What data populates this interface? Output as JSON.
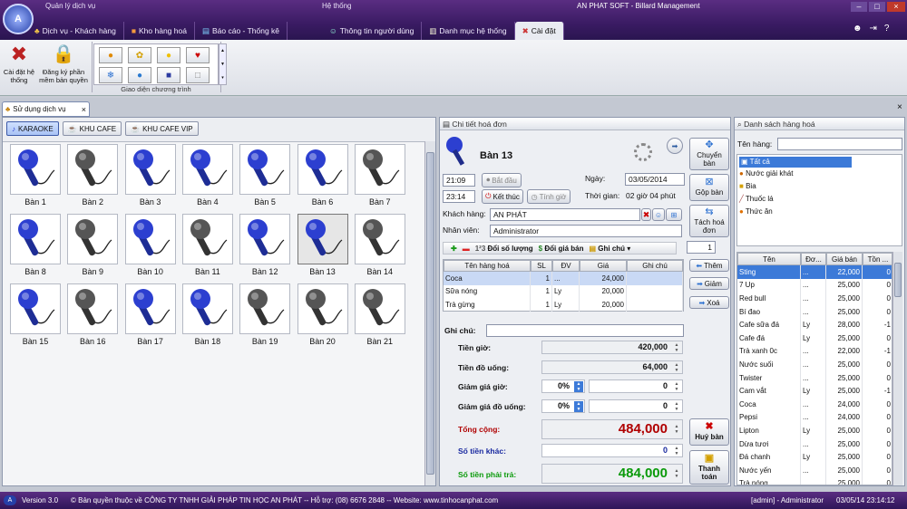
{
  "app": {
    "title": "AN PHAT SOFT - Billard Management",
    "menu_left": "Quản lý dịch vụ",
    "menu_mid": "Hệ thống"
  },
  "tabs": [
    "Dịch vụ - Khách hàng",
    "Kho hàng hoá",
    "Báo cáo - Thống kê",
    "Thông tin người dùng",
    "Danh mục hệ thống",
    "Cài đặt"
  ],
  "ribbon": {
    "settings": "Cài đặt hệ thống",
    "license": "Đăng ký phần mềm bản quyền",
    "theme_group": "Giao diện chương trình"
  },
  "doc_tab": "Sử dụng dịch vụ",
  "areas": [
    "KARAOKE",
    "KHU CAFE",
    "KHU CAFE VIP"
  ],
  "tables": [
    {
      "name": "Bàn 1",
      "state": "busy"
    },
    {
      "name": "Bàn 2",
      "state": "free"
    },
    {
      "name": "Bàn 3",
      "state": "busy"
    },
    {
      "name": "Bàn 4",
      "state": "busy"
    },
    {
      "name": "Bàn 5",
      "state": "busy"
    },
    {
      "name": "Bàn 6",
      "state": "busy"
    },
    {
      "name": "Bàn 7",
      "state": "free"
    },
    {
      "name": "Bàn 8",
      "state": "busy"
    },
    {
      "name": "Bàn 9",
      "state": "free"
    },
    {
      "name": "Bàn 10",
      "state": "busy"
    },
    {
      "name": "Bàn 11",
      "state": "free"
    },
    {
      "name": "Bàn 12",
      "state": "busy"
    },
    {
      "name": "Bàn 13",
      "state": "selected"
    },
    {
      "name": "Bàn 14",
      "state": "free"
    },
    {
      "name": "Bàn 15",
      "state": "busy"
    },
    {
      "name": "Bàn 16",
      "state": "free"
    },
    {
      "name": "Bàn 17",
      "state": "busy"
    },
    {
      "name": "Bàn 18",
      "state": "busy"
    },
    {
      "name": "Bàn 19",
      "state": "free"
    },
    {
      "name": "Bàn 20",
      "state": "free"
    },
    {
      "name": "Bàn 21",
      "state": "free"
    }
  ],
  "detail": {
    "header": "Chi tiết hoá đơn",
    "table_name": "Bàn 13",
    "start_time": "21:09",
    "start_btn": "Bắt đầu",
    "end_time": "23:14",
    "end_btn": "Kết thúc",
    "calc_btn": "Tính giờ",
    "date_label": "Ngày:",
    "date": "03/05/2014",
    "time_label": "Thời gian:",
    "duration": "02 giờ 04 phút",
    "customer_label": "Khách hàng:",
    "customer": "AN PHÁT",
    "staff_label": "Nhân viên:",
    "staff": "Administrator",
    "tool_qty": "Đổi số lượng",
    "tool_price": "Đổi giá bán",
    "tool_note": "Ghi chú",
    "qty": "1",
    "cols": [
      "Tên hàng hoá",
      "SL",
      "ĐV",
      "Giá",
      "Ghi chú"
    ],
    "items": [
      {
        "name": "Coca",
        "qty": "1",
        "unit": "...",
        "price": "24,000"
      },
      {
        "name": "Sữa nóng",
        "qty": "1",
        "unit": "Ly",
        "price": "20,000"
      },
      {
        "name": "Trà gừng",
        "qty": "1",
        "unit": "Ly",
        "price": "20,000"
      }
    ],
    "note_label": "Ghi chú:",
    "hours_label": "Tiền giờ:",
    "hours_val": "420,000",
    "drinks_label": "Tiền đồ uống:",
    "drinks_val": "64,000",
    "disc_h_label": "Giảm giá giờ:",
    "disc_h_pct": "0%",
    "disc_h_val": "0",
    "disc_d_label": "Giảm giá đồ uống:",
    "disc_d_pct": "0%",
    "disc_d_val": "0",
    "total_label": "Tổng cộng:",
    "total_val": "484,000",
    "other_label": "Số tiền khác:",
    "other_val": "0",
    "pay_label": "Số tiền phải trả:",
    "pay_val": "484,000"
  },
  "actions": {
    "move": "Chuyển bàn",
    "merge": "Gộp bàn",
    "split": "Tách hoá đơn",
    "add": "Thêm",
    "reduce": "Giảm",
    "delete": "Xoá",
    "cancel": "Huỷ bàn",
    "checkout": "Thanh toán"
  },
  "products": {
    "header": "Danh sách hàng hoá",
    "name_label": "Tên hàng:",
    "categories": [
      "Tất cả",
      "Nước giải khát",
      "Bia",
      "Thuốc lá",
      "Thức ăn"
    ],
    "cols": [
      "Tên",
      "Đơ...",
      "Giá bán",
      "Tồn ..."
    ],
    "items": [
      {
        "name": "Sting",
        "unit": "...",
        "price": "22,000",
        "stock": "0"
      },
      {
        "name": "7 Up",
        "unit": "...",
        "price": "25,000",
        "stock": "0"
      },
      {
        "name": "Red bull",
        "unit": "...",
        "price": "25,000",
        "stock": "0"
      },
      {
        "name": "Bí đao",
        "unit": "...",
        "price": "25,000",
        "stock": "0"
      },
      {
        "name": "Cafe sữa đá",
        "unit": "Ly",
        "price": "28,000",
        "stock": "-1"
      },
      {
        "name": "Cafe đá",
        "unit": "Ly",
        "price": "25,000",
        "stock": "0"
      },
      {
        "name": "Trà xanh 0c",
        "unit": "...",
        "price": "22,000",
        "stock": "-1"
      },
      {
        "name": "Nước suối",
        "unit": "...",
        "price": "25,000",
        "stock": "0"
      },
      {
        "name": "Twister",
        "unit": "...",
        "price": "25,000",
        "stock": "0"
      },
      {
        "name": "Cam vắt",
        "unit": "Ly",
        "price": "25,000",
        "stock": "-1"
      },
      {
        "name": "Coca",
        "unit": "...",
        "price": "24,000",
        "stock": "0"
      },
      {
        "name": "Pepsi",
        "unit": "...",
        "price": "24,000",
        "stock": "0"
      },
      {
        "name": "Lipton",
        "unit": "Ly",
        "price": "25,000",
        "stock": "0"
      },
      {
        "name": "Dừa tươi",
        "unit": "...",
        "price": "25,000",
        "stock": "0"
      },
      {
        "name": "Đá chanh",
        "unit": "Ly",
        "price": "25,000",
        "stock": "0"
      },
      {
        "name": "Nước yến",
        "unit": "...",
        "price": "25,000",
        "stock": "0"
      },
      {
        "name": "Trà nóng",
        "unit": "...",
        "price": "25,000",
        "stock": "0"
      }
    ]
  },
  "status": {
    "version": "Version 3.0",
    "copyright": "© Bản quyền thuộc về CÔNG TY TNHH GIẢI PHÁP TIN HỌC AN PHÁT  -- Hỗ trợ: (08) 6676 2848  -- Website: www.tinhocanphat.com",
    "user": "[admin] - Administrator",
    "datetime": "03/05/14 23:14:12"
  },
  "colors": {
    "accent": "#5a2d82",
    "mic_busy": "#2c3fd0",
    "mic_free": "#555555",
    "total_red": "#b00000",
    "pay_green": "#0a9a0a",
    "other_blue": "#1a2aa0"
  }
}
